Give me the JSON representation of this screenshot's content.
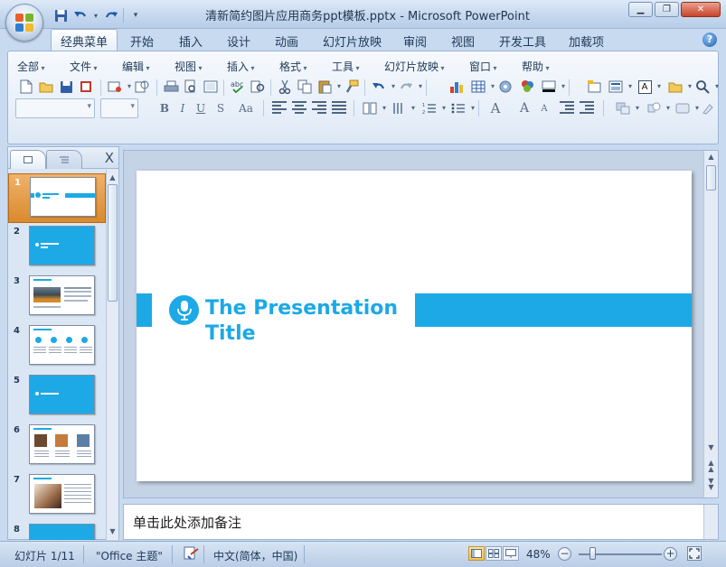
{
  "window": {
    "title": "清新简约图片应用商务ppt模板.pptx - Microsoft PowerPoint"
  },
  "quick_access": {
    "icons": [
      "save-icon",
      "undo-icon",
      "redo-icon",
      "customize-icon"
    ]
  },
  "ribbon_tabs": [
    {
      "label": "经典菜单",
      "active": true
    },
    {
      "label": "开始"
    },
    {
      "label": "插入"
    },
    {
      "label": "设计"
    },
    {
      "label": "动画"
    },
    {
      "label": "幻灯片放映"
    },
    {
      "label": "审阅"
    },
    {
      "label": "视图"
    },
    {
      "label": "开发工具"
    },
    {
      "label": "加载项"
    }
  ],
  "classic_menu": [
    "全部",
    "文件",
    "编辑",
    "视图",
    "插入",
    "格式",
    "工具",
    "幻灯片放映",
    "窗口",
    "帮助"
  ],
  "toolbar": {
    "text_color_label": "A"
  },
  "formatting": {
    "bold": "B",
    "italic": "I",
    "underline": "U",
    "shadow": "S",
    "case": "Aa",
    "grow_font": "A",
    "shrink_font": "A",
    "font_color": "A"
  },
  "panes": {
    "close": "X"
  },
  "slides": [
    {
      "num": "1",
      "selected": true
    },
    {
      "num": "2"
    },
    {
      "num": "3"
    },
    {
      "num": "4"
    },
    {
      "num": "5"
    },
    {
      "num": "6"
    },
    {
      "num": "7"
    },
    {
      "num": "8"
    }
  ],
  "slide": {
    "title": "The Presentation Title",
    "accent_color": "#1CA9E6"
  },
  "notes": {
    "placeholder": "单击此处添加备注"
  },
  "statusbar": {
    "slide_counter": "幻灯片 1/11",
    "theme": "\"Office 主题\"",
    "language": "中文(简体，中国)",
    "zoom": "48%",
    "zoom_fraction": 0.48
  }
}
